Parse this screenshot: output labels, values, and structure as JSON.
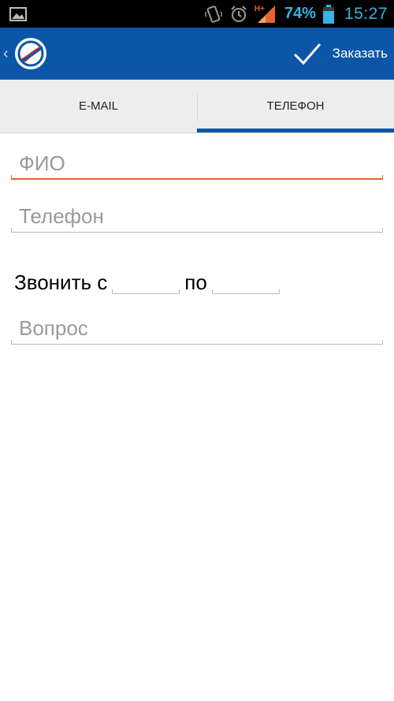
{
  "status_bar": {
    "battery_percent": "74%",
    "time": "15:27",
    "network_type": "H+",
    "icons": [
      "gallery-icon",
      "vibrate-icon",
      "alarm-icon",
      "signal-icon",
      "battery-icon"
    ]
  },
  "action_bar": {
    "order_label": "Заказать",
    "icons": [
      "back-chevron-icon",
      "app-logo",
      "check-icon"
    ],
    "colors": {
      "bar": "#0b56a6",
      "accent": "#e4662a"
    }
  },
  "tabs": [
    {
      "label": "E-MAIL",
      "active": false
    },
    {
      "label": "ТЕЛЕФОН",
      "active": true
    }
  ],
  "form": {
    "name_field": {
      "placeholder": "ФИО",
      "value": ""
    },
    "phone_field": {
      "placeholder": "Телефон",
      "value": ""
    },
    "call_from_label": "Звонить с",
    "call_to_label": "по",
    "call_from_value": "",
    "call_to_value": "",
    "question_field": {
      "placeholder": "Вопрос",
      "value": ""
    }
  }
}
